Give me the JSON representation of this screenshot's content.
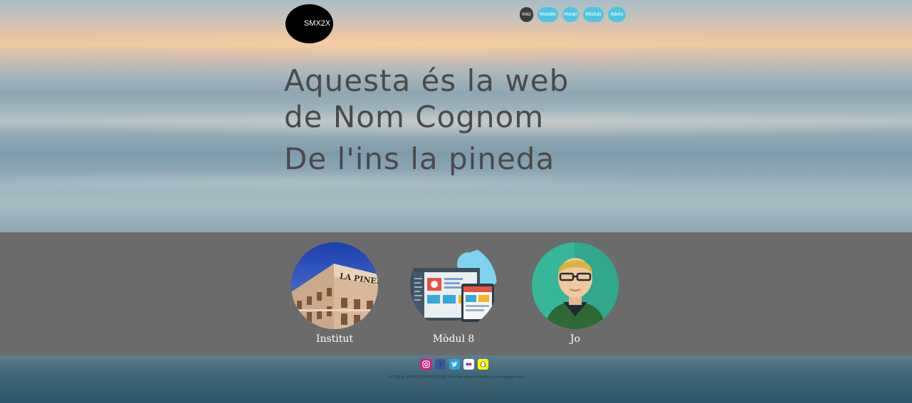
{
  "header": {
    "logo_text": "SMX2X",
    "nav": [
      {
        "label": "Inici",
        "active": true
      },
      {
        "label": "Moodle",
        "active": false
      },
      {
        "label": "Horari",
        "active": false
      },
      {
        "label": "Mòduls",
        "active": false
      },
      {
        "label": "Altres",
        "active": false
      }
    ]
  },
  "hero": {
    "headline_line1": "Aquesta és la web",
    "headline_line2": "de Nom Cognom",
    "subheadline": "De l'ins la pineda"
  },
  "cards": [
    {
      "label": "Institut",
      "image": "school-building"
    },
    {
      "label": "Mòdul 8",
      "image": "web-design-illustration"
    },
    {
      "label": "Jo",
      "image": "avatar-illustration"
    }
  ],
  "footer": {
    "social": [
      {
        "name": "instagram-icon",
        "color": "#e4157a"
      },
      {
        "name": "facebook-icon",
        "color": "#3b5998"
      },
      {
        "name": "twitter-icon",
        "color": "#2ea4de"
      },
      {
        "name": "flickr-icon",
        "color": "#ffffff"
      },
      {
        "name": "snapchat-icon",
        "color": "#fffc00"
      }
    ],
    "copyright": "© 2018 by NOM COGNOM DESIGN. No s'han utilitzat animals per a fer aquesta web"
  },
  "colors": {
    "accent": "#4fc4e0",
    "nav_active": "#3b3b3b",
    "band": "#6b6b6b",
    "heading": "#4a4a4a"
  }
}
